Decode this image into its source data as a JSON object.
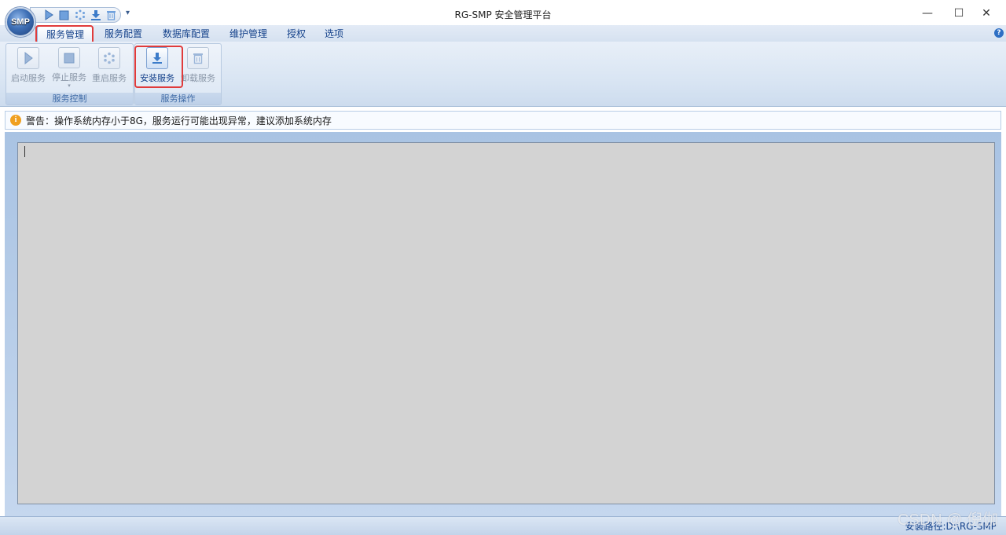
{
  "window": {
    "title": "RG-SMP 安全管理平台",
    "orb_label": "SMP",
    "minimize": "—",
    "maximize": "☐",
    "close": "✕"
  },
  "quick_access": {
    "items": [
      "play-icon",
      "stop-icon",
      "restart-icon",
      "install-icon",
      "trash-icon"
    ],
    "more": "▾"
  },
  "tabs": [
    {
      "label": "服务管理",
      "active": true
    },
    {
      "label": "服务配置"
    },
    {
      "label": "数据库配置"
    },
    {
      "label": "维护管理"
    },
    {
      "label": "授权"
    },
    {
      "label": "选项"
    }
  ],
  "help": "?",
  "ribbon": {
    "groups": [
      {
        "label": "服务控制",
        "buttons": [
          {
            "label": "启动服务",
            "icon": "play-icon",
            "enabled": false
          },
          {
            "label": "停止服务",
            "icon": "stop-icon",
            "enabled": false,
            "caret": "▾"
          },
          {
            "label": "重启服务",
            "icon": "restart-icon",
            "enabled": false
          }
        ]
      },
      {
        "label": "服务操作",
        "buttons": [
          {
            "label": "安装服务",
            "icon": "install-icon",
            "enabled": true
          },
          {
            "label": "卸载服务",
            "icon": "trash-icon",
            "enabled": false
          }
        ]
      }
    ]
  },
  "warning": {
    "icon": "i",
    "text": "警告：操作系统内存小于8G，服务运行可能出现异常，建议添加系统内存"
  },
  "log": {
    "content": ""
  },
  "status": {
    "text": "安装路径:D:\\RG-SMP"
  },
  "watermark": "CSDN @ 倪伽",
  "colors": {
    "accent": "#15428b",
    "highlight": "#e03b3b",
    "warning": "#f0a020"
  }
}
